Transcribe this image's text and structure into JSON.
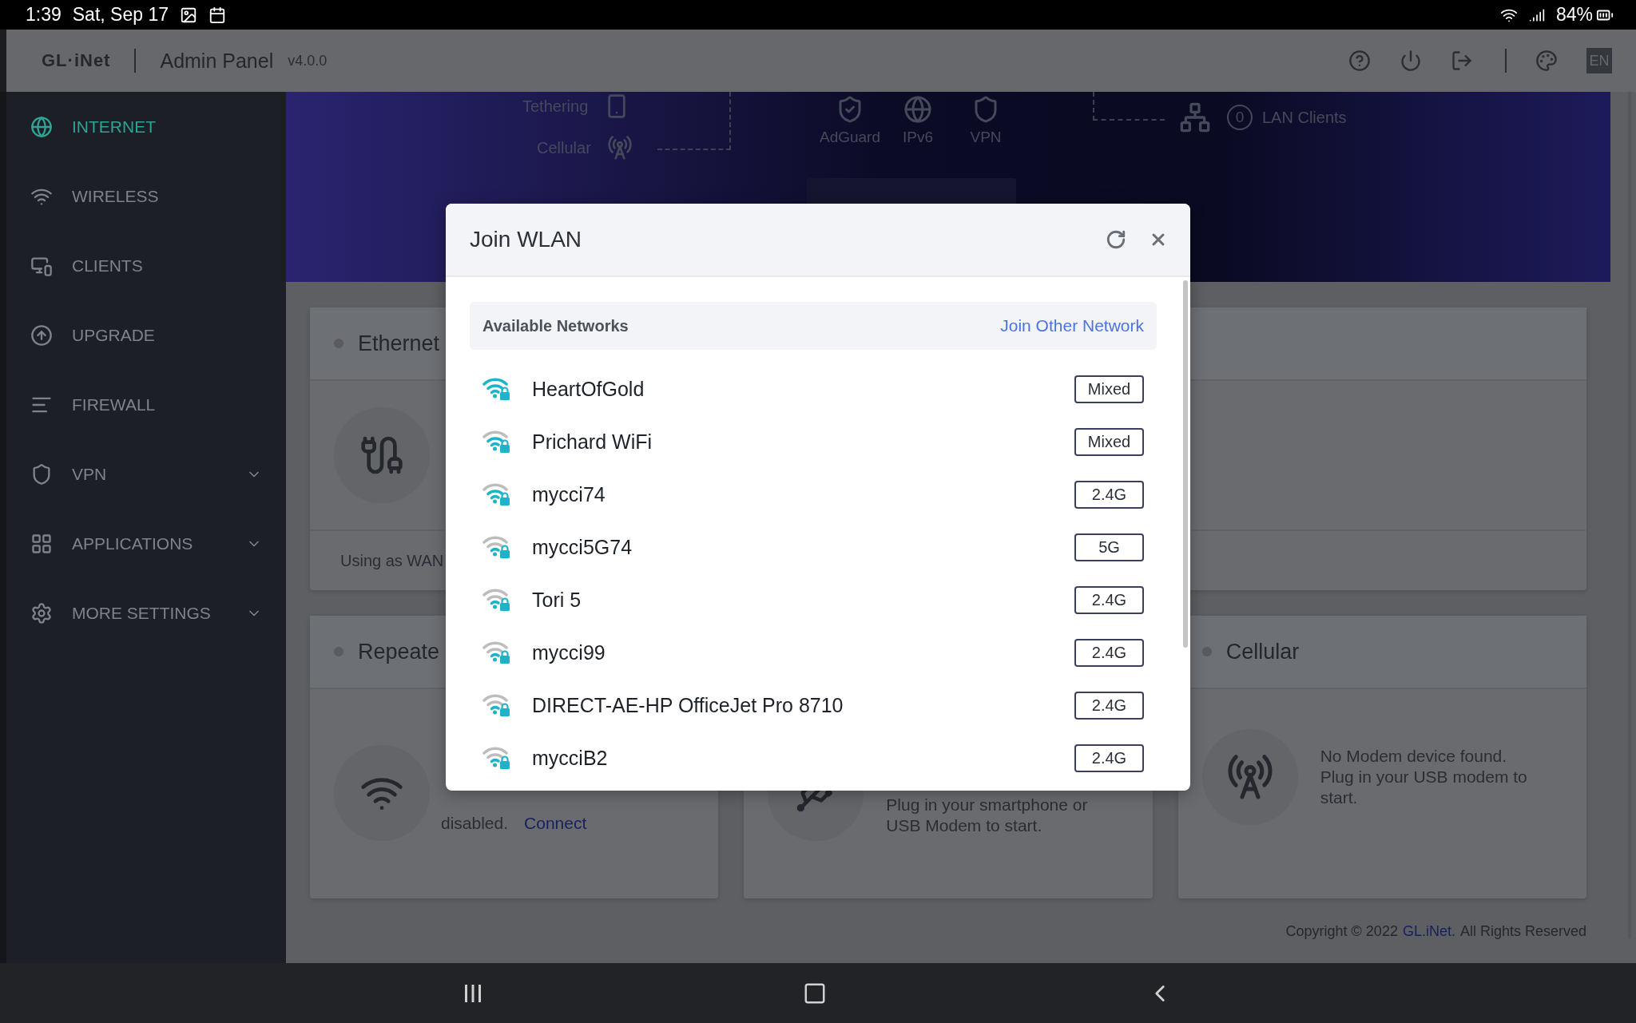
{
  "status_bar": {
    "time": "1:39",
    "date": "Sat, Sep 17",
    "battery": "84%"
  },
  "header": {
    "logo": "GL·iNet",
    "title": "Admin Panel",
    "version": "v4.0.0",
    "language": "EN"
  },
  "sidebar": {
    "items": [
      {
        "label": "INTERNET",
        "selected": true,
        "expandable": false
      },
      {
        "label": "WIRELESS",
        "selected": false,
        "expandable": false
      },
      {
        "label": "CLIENTS",
        "selected": false,
        "expandable": false
      },
      {
        "label": "UPGRADE",
        "selected": false,
        "expandable": false
      },
      {
        "label": "FIREWALL",
        "selected": false,
        "expandable": false
      },
      {
        "label": "VPN",
        "selected": false,
        "expandable": true
      },
      {
        "label": "APPLICATIONS",
        "selected": false,
        "expandable": true
      },
      {
        "label": "MORE SETTINGS",
        "selected": false,
        "expandable": true
      }
    ]
  },
  "topology": {
    "sources": [
      "Tethering",
      "Cellular"
    ],
    "services": [
      "AdGuard",
      "IPv6",
      "VPN"
    ],
    "lan_count": "0",
    "lan_label": "LAN Clients"
  },
  "cards": {
    "ethernet": {
      "title": "Ethernet",
      "status": "Using as WAN"
    },
    "repeater": {
      "title": "Repeate",
      "status": "disabled.",
      "link": "Connect"
    },
    "tethering": {
      "message": "Plug in your smartphone or USB Modem to start."
    },
    "cellular": {
      "title": "Cellular",
      "message": "No Modem device found. Plug in your USB modem to start."
    }
  },
  "footer": {
    "copyright": "Copyright © 2022",
    "link": "GL.iNet.",
    "rights": "All Rights Reserved"
  },
  "dialog": {
    "title": "Join WLAN",
    "section": "Available Networks",
    "join_other": "Join Other Network",
    "networks": [
      {
        "ssid": "HeartOfGold",
        "band": "Mixed",
        "kind": "strong"
      },
      {
        "ssid": "Prichard WiFi",
        "band": "Mixed",
        "kind": "medium"
      },
      {
        "ssid": "mycci74",
        "band": "2.4G",
        "kind": "medium"
      },
      {
        "ssid": "mycci5G74",
        "band": "5G",
        "kind": "weak"
      },
      {
        "ssid": "Tori 5",
        "band": "2.4G",
        "kind": "weak"
      },
      {
        "ssid": "mycci99",
        "band": "2.4G",
        "kind": "weak"
      },
      {
        "ssid": "DIRECT-AE-HP OfficeJet Pro 8710",
        "band": "2.4G",
        "kind": "weak"
      },
      {
        "ssid": "mycciB2",
        "band": "2.4G",
        "kind": "weak"
      }
    ]
  }
}
